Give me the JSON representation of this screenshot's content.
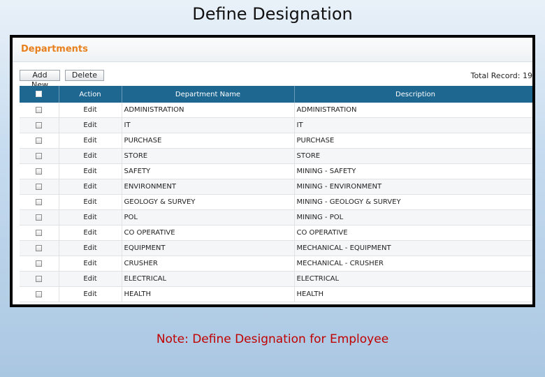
{
  "slide": {
    "title": "Define Designation",
    "note": "Note:  Define Designation for Employee"
  },
  "panel": {
    "header": "Departments",
    "add_label": "Add New",
    "delete_label": "Delete",
    "total_text": "Total Record: 19"
  },
  "table": {
    "columns": [
      "",
      "Action",
      "Department Name",
      "Description"
    ],
    "rows": [
      {
        "action": "Edit",
        "name": "ADMINISTRATION",
        "description": "ADMINISTRATION"
      },
      {
        "action": "Edit",
        "name": "IT",
        "description": "IT"
      },
      {
        "action": "Edit",
        "name": "PURCHASE",
        "description": "PURCHASE"
      },
      {
        "action": "Edit",
        "name": "STORE",
        "description": "STORE"
      },
      {
        "action": "Edit",
        "name": "SAFETY",
        "description": "MINING - SAFETY"
      },
      {
        "action": "Edit",
        "name": "ENVIRONMENT",
        "description": "MINING - ENVIRONMENT"
      },
      {
        "action": "Edit",
        "name": "GEOLOGY & SURVEY",
        "description": "MINING - GEOLOGY & SURVEY"
      },
      {
        "action": "Edit",
        "name": "POL",
        "description": "MINING - POL"
      },
      {
        "action": "Edit",
        "name": "CO OPERATIVE",
        "description": "CO OPERATIVE"
      },
      {
        "action": "Edit",
        "name": "EQUIPMENT",
        "description": "MECHANICAL - EQUIPMENT"
      },
      {
        "action": "Edit",
        "name": "CRUSHER",
        "description": "MECHANICAL - CRUSHER"
      },
      {
        "action": "Edit",
        "name": "ELECTRICAL",
        "description": "ELECTRICAL"
      },
      {
        "action": "Edit",
        "name": "HEALTH",
        "description": "HEALTH"
      }
    ]
  },
  "colors": {
    "header_orange": "#e8801e",
    "table_header_blue": "#1d6791",
    "edit_link": "#2a73b3",
    "note_red": "#c00000"
  }
}
